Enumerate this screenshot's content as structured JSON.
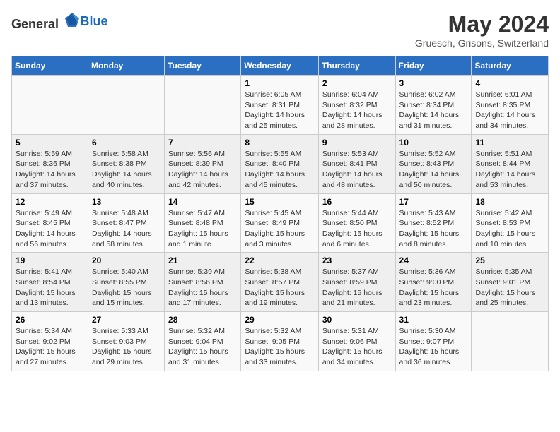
{
  "header": {
    "logo_general": "General",
    "logo_blue": "Blue",
    "title": "May 2024",
    "subtitle": "Gruesch, Grisons, Switzerland"
  },
  "calendar": {
    "weekdays": [
      "Sunday",
      "Monday",
      "Tuesday",
      "Wednesday",
      "Thursday",
      "Friday",
      "Saturday"
    ],
    "weeks": [
      [
        {
          "day": "",
          "detail": ""
        },
        {
          "day": "",
          "detail": ""
        },
        {
          "day": "",
          "detail": ""
        },
        {
          "day": "1",
          "detail": "Sunrise: 6:05 AM\nSunset: 8:31 PM\nDaylight: 14 hours\nand 25 minutes."
        },
        {
          "day": "2",
          "detail": "Sunrise: 6:04 AM\nSunset: 8:32 PM\nDaylight: 14 hours\nand 28 minutes."
        },
        {
          "day": "3",
          "detail": "Sunrise: 6:02 AM\nSunset: 8:34 PM\nDaylight: 14 hours\nand 31 minutes."
        },
        {
          "day": "4",
          "detail": "Sunrise: 6:01 AM\nSunset: 8:35 PM\nDaylight: 14 hours\nand 34 minutes."
        }
      ],
      [
        {
          "day": "5",
          "detail": "Sunrise: 5:59 AM\nSunset: 8:36 PM\nDaylight: 14 hours\nand 37 minutes."
        },
        {
          "day": "6",
          "detail": "Sunrise: 5:58 AM\nSunset: 8:38 PM\nDaylight: 14 hours\nand 40 minutes."
        },
        {
          "day": "7",
          "detail": "Sunrise: 5:56 AM\nSunset: 8:39 PM\nDaylight: 14 hours\nand 42 minutes."
        },
        {
          "day": "8",
          "detail": "Sunrise: 5:55 AM\nSunset: 8:40 PM\nDaylight: 14 hours\nand 45 minutes."
        },
        {
          "day": "9",
          "detail": "Sunrise: 5:53 AM\nSunset: 8:41 PM\nDaylight: 14 hours\nand 48 minutes."
        },
        {
          "day": "10",
          "detail": "Sunrise: 5:52 AM\nSunset: 8:43 PM\nDaylight: 14 hours\nand 50 minutes."
        },
        {
          "day": "11",
          "detail": "Sunrise: 5:51 AM\nSunset: 8:44 PM\nDaylight: 14 hours\nand 53 minutes."
        }
      ],
      [
        {
          "day": "12",
          "detail": "Sunrise: 5:49 AM\nSunset: 8:45 PM\nDaylight: 14 hours\nand 56 minutes."
        },
        {
          "day": "13",
          "detail": "Sunrise: 5:48 AM\nSunset: 8:47 PM\nDaylight: 14 hours\nand 58 minutes."
        },
        {
          "day": "14",
          "detail": "Sunrise: 5:47 AM\nSunset: 8:48 PM\nDaylight: 15 hours\nand 1 minute."
        },
        {
          "day": "15",
          "detail": "Sunrise: 5:45 AM\nSunset: 8:49 PM\nDaylight: 15 hours\nand 3 minutes."
        },
        {
          "day": "16",
          "detail": "Sunrise: 5:44 AM\nSunset: 8:50 PM\nDaylight: 15 hours\nand 6 minutes."
        },
        {
          "day": "17",
          "detail": "Sunrise: 5:43 AM\nSunset: 8:52 PM\nDaylight: 15 hours\nand 8 minutes."
        },
        {
          "day": "18",
          "detail": "Sunrise: 5:42 AM\nSunset: 8:53 PM\nDaylight: 15 hours\nand 10 minutes."
        }
      ],
      [
        {
          "day": "19",
          "detail": "Sunrise: 5:41 AM\nSunset: 8:54 PM\nDaylight: 15 hours\nand 13 minutes."
        },
        {
          "day": "20",
          "detail": "Sunrise: 5:40 AM\nSunset: 8:55 PM\nDaylight: 15 hours\nand 15 minutes."
        },
        {
          "day": "21",
          "detail": "Sunrise: 5:39 AM\nSunset: 8:56 PM\nDaylight: 15 hours\nand 17 minutes."
        },
        {
          "day": "22",
          "detail": "Sunrise: 5:38 AM\nSunset: 8:57 PM\nDaylight: 15 hours\nand 19 minutes."
        },
        {
          "day": "23",
          "detail": "Sunrise: 5:37 AM\nSunset: 8:59 PM\nDaylight: 15 hours\nand 21 minutes."
        },
        {
          "day": "24",
          "detail": "Sunrise: 5:36 AM\nSunset: 9:00 PM\nDaylight: 15 hours\nand 23 minutes."
        },
        {
          "day": "25",
          "detail": "Sunrise: 5:35 AM\nSunset: 9:01 PM\nDaylight: 15 hours\nand 25 minutes."
        }
      ],
      [
        {
          "day": "26",
          "detail": "Sunrise: 5:34 AM\nSunset: 9:02 PM\nDaylight: 15 hours\nand 27 minutes."
        },
        {
          "day": "27",
          "detail": "Sunrise: 5:33 AM\nSunset: 9:03 PM\nDaylight: 15 hours\nand 29 minutes."
        },
        {
          "day": "28",
          "detail": "Sunrise: 5:32 AM\nSunset: 9:04 PM\nDaylight: 15 hours\nand 31 minutes."
        },
        {
          "day": "29",
          "detail": "Sunrise: 5:32 AM\nSunset: 9:05 PM\nDaylight: 15 hours\nand 33 minutes."
        },
        {
          "day": "30",
          "detail": "Sunrise: 5:31 AM\nSunset: 9:06 PM\nDaylight: 15 hours\nand 34 minutes."
        },
        {
          "day": "31",
          "detail": "Sunrise: 5:30 AM\nSunset: 9:07 PM\nDaylight: 15 hours\nand 36 minutes."
        },
        {
          "day": "",
          "detail": ""
        }
      ]
    ]
  }
}
